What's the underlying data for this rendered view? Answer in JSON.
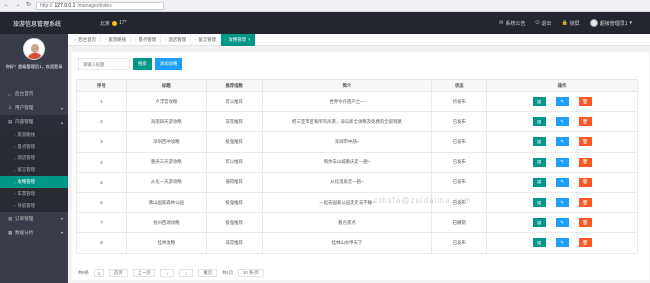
{
  "browser": {
    "back": "←",
    "forward": "→",
    "reload": "↻",
    "url_prefix": "http://",
    "url_host": "127.0.0.1",
    "url_path": "/manager/index"
  },
  "header": {
    "logo": "旅游信息管理系统",
    "weather_label": "北京",
    "weather_temp": "17°",
    "links": [
      {
        "icon": "email-icon",
        "glyph": "✉",
        "label": "系统公告"
      },
      {
        "icon": "logout-icon",
        "glyph": "⏻",
        "label": "退出"
      },
      {
        "icon": "lock-icon",
        "glyph": "🔒",
        "label": "锁屏"
      }
    ],
    "user": "超级管理员1",
    "user_caret": "▾"
  },
  "sidebar": {
    "profile_name": "你好！超级管理员1，欢迎登录",
    "items": [
      {
        "label": "后台首页",
        "glyph": "⌂",
        "arrow": ""
      },
      {
        "label": "用户管理",
        "glyph": "♙",
        "arrow": "▾"
      },
      {
        "label": "内容管理",
        "glyph": "▤",
        "arrow": "▴"
      }
    ],
    "subitems": [
      {
        "label": "旅游路线",
        "glyph": "▫"
      },
      {
        "label": "景点管理",
        "glyph": "▫"
      },
      {
        "label": "酒店管理",
        "glyph": "▫"
      },
      {
        "label": "留言管理",
        "glyph": "▫"
      },
      {
        "label": "攻略管理",
        "glyph": "▫"
      },
      {
        "label": "车票管理",
        "glyph": "▫"
      },
      {
        "label": "导航管理",
        "glyph": "▫"
      }
    ],
    "items_after": [
      {
        "label": "订单管理",
        "glyph": "▥",
        "arrow": "▾"
      },
      {
        "label": "数据分析",
        "glyph": "▦",
        "arrow": "▾"
      }
    ]
  },
  "tabs": [
    {
      "label": "后台首页",
      "glyph": "⌂",
      "close": ""
    },
    {
      "label": "旅游路线",
      "glyph": "▫",
      "close": ""
    },
    {
      "label": "景点管理",
      "glyph": "▫",
      "close": ""
    },
    {
      "label": "酒店管理",
      "glyph": "▫",
      "close": ""
    },
    {
      "label": "留言管理",
      "glyph": "▫",
      "close": ""
    },
    {
      "label": "攻略管理",
      "glyph": "▫",
      "close": "×"
    }
  ],
  "search": {
    "placeholder": "请输入标题",
    "search_label": "搜索",
    "add_label": "添加攻略"
  },
  "table": {
    "headers": [
      "序号",
      "标题",
      "推荐指数",
      "简介",
      "状态",
      "操作"
    ],
    "rows": [
      {
        "no": "1",
        "title": "卢浮宫攻略",
        "rec": "可以推荐",
        "desc": "世界今存遗产之一",
        "status": "待发布"
      },
      {
        "no": "2",
        "title": "海南四天游攻略",
        "rec": "非常推荐",
        "desc": "把三亚市区和所有风景，海岛新全攻略及免费的全部到路",
        "status": "已发布"
      },
      {
        "no": "3",
        "title": "深圳西冲攻略",
        "rec": "极强推荐",
        "desc": "深圳市中部~",
        "status": "已发布"
      },
      {
        "no": "4",
        "title": "重庆三天游攻略",
        "rec": "可以推荐",
        "desc": "和你去山城重庆走一趟~",
        "status": "已发布"
      },
      {
        "no": "5",
        "title": "从化一天游攻略",
        "rec": "值得推荐",
        "desc": "从化温泉走一趟~",
        "status": "已发布"
      },
      {
        "no": "6",
        "title": "佛山国家森林公园",
        "rec": "极强推荐",
        "desc": "一起去国家公园走走去不睡~",
        "status": "已发布"
      },
      {
        "no": "7",
        "title": "杭州西湖攻略",
        "rec": "极强推荐",
        "desc": "看名景点",
        "status": "已撤销"
      },
      {
        "no": "8",
        "title": "桂林攻略",
        "rec": "非常推荐",
        "desc": "桂林山水甲天下",
        "status": "已发布"
      }
    ],
    "op_icons": {
      "view": "▤",
      "edit": "✎",
      "del": "🗑"
    }
  },
  "pager": {
    "total": "共8条",
    "page": "1",
    "first": "首页",
    "prev": "上一页",
    "prev_arrow": "‹",
    "next_arrow": "›",
    "last": "尾页",
    "pages": "共1页",
    "per": "10 条/页"
  },
  "watermark": "cthxfa@zuidaima.com"
}
